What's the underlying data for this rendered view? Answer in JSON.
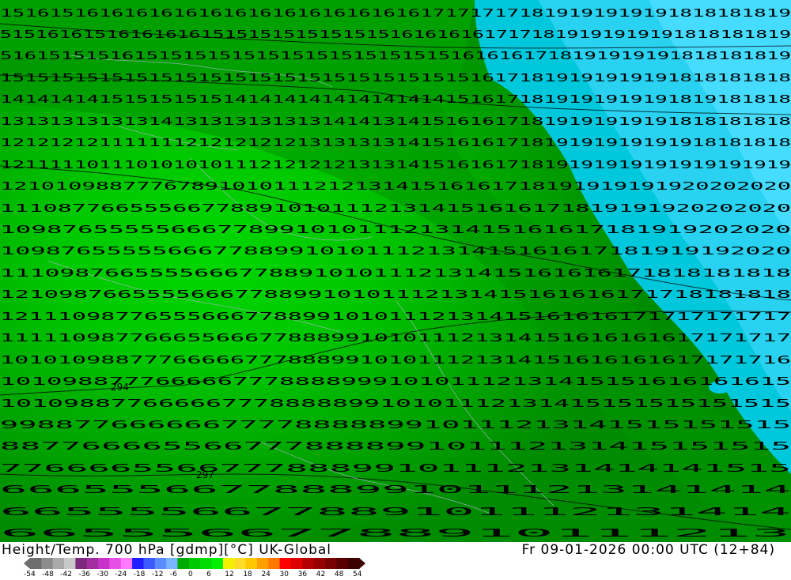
{
  "footer": {
    "title": "Height/Temp. 700 hPa [gdmp][°C] UK-Global",
    "time": "Fr 09-01-2026 00:00 UTC (12+84)"
  },
  "colorbar": {
    "labels": [
      "-54",
      "-48",
      "-42",
      "-36",
      "-30",
      "-24",
      "-18",
      "-12",
      "-6",
      "0",
      "6",
      "12",
      "18",
      "24",
      "30",
      "36",
      "42",
      "48",
      "54"
    ],
    "colors": [
      "#6e6e6e",
      "#8c8c8c",
      "#aaaaaa",
      "#c8c8c8",
      "#7d2a7d",
      "#a02ea0",
      "#c832c8",
      "#e650e6",
      "#ff78ff",
      "#1e1eff",
      "#3c5aff",
      "#5a8cff",
      "#78b4ff",
      "#00aa00",
      "#00c800",
      "#00dc00",
      "#00f000",
      "#f0f000",
      "#ffdc28",
      "#ffc800",
      "#ffa000",
      "#ff7800",
      "#ff0000",
      "#dc0000",
      "#b40000",
      "#960000",
      "#780000",
      "#5a0000",
      "#3c0000"
    ]
  },
  "map": {
    "contour_labels": {
      "height_1": "294",
      "height_2": "297"
    },
    "rows": [
      "1516151616161616161616161616161616171717171819191919191818181819",
      "5151616151616161615151515151515151616161617171819191919191818181819",
      "51615151516151515151515151515151515151616161718191919191818181819",
      "1515151515151515151515151515151515151516171819191919191818181818",
      "1414141415151515151414141414141414141516171819191919191819181818",
      "1313131313131413131313131314141314151616171819191919191818181818",
      "1212121211111112121212121313131314151616171819191919191918181818",
      "1211111011101010101112121212131314151616171819191919191919191919",
      "1210109887776789101011121213141516161718191919191920202020",
      "1110877665556677889101011121314151616171819191920202020",
      "109876555556667789910101112131415161617181919202020",
      "1098765555566677889910101112131415161617181919192020",
      "11109876655556667788910101112131415161616171818181818",
      "121098766555566677889910101112131415161616171718181818",
      "1211109877655566677889910101112131415161616171717171717",
      "1111109877666556667788899101011121314151616161617171717",
      "1010109887776666677788899101011121314151616161617171716",
      "101098877766666777888899910101112131415151616161615",
      "10109887766666777888889910101112131415151515151515",
      "9988776666667777888889910111213141515151515",
      "887766665566777888899101112131415151515",
      "776666556677788899101112131414141515",
      "66655566778889910111213141414",
      "6655556677889101112131414",
      "66555667788910111213"
    ]
  }
}
